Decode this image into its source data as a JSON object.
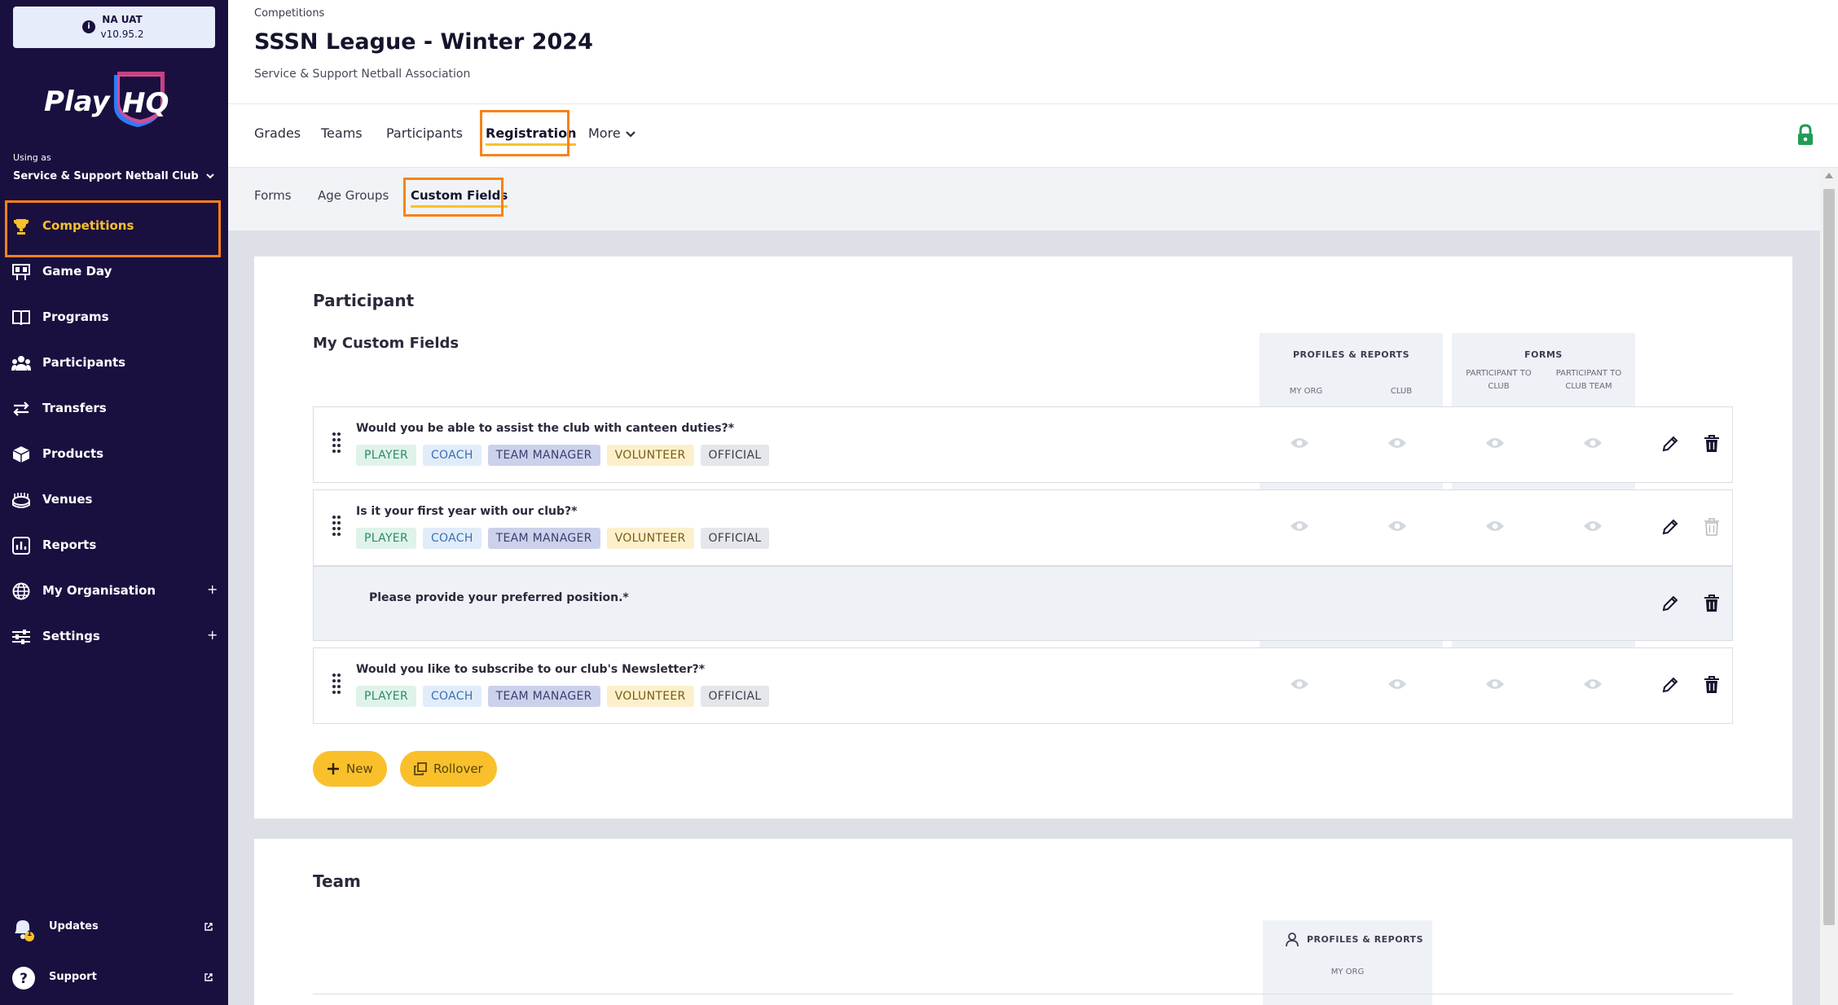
{
  "env": {
    "name": "NA UAT",
    "version": "v10.95.2",
    "info_icon": "i"
  },
  "sidebar": {
    "using_as_label": "Using as",
    "org_name": "Service & Support Netball Club",
    "items": [
      {
        "label": "Competitions",
        "icon": "trophy-icon",
        "active": true
      },
      {
        "label": "Game Day",
        "icon": "scoreboard-icon"
      },
      {
        "label": "Programs",
        "icon": "book-icon"
      },
      {
        "label": "Participants",
        "icon": "people-icon"
      },
      {
        "label": "Transfers",
        "icon": "transfer-arrows-icon"
      },
      {
        "label": "Products",
        "icon": "boxes-icon"
      },
      {
        "label": "Venues",
        "icon": "stadium-icon"
      },
      {
        "label": "Reports",
        "icon": "report-chart-icon"
      },
      {
        "label": "My Organisation",
        "icon": "globe-icon",
        "expand": "+"
      },
      {
        "label": "Settings",
        "icon": "sliders-icon",
        "expand": "+"
      }
    ],
    "updates": {
      "label": "Updates",
      "badge": "1"
    },
    "support": {
      "label": "Support"
    }
  },
  "header": {
    "breadcrumb": "Competitions",
    "title": "SSSN League - Winter 2024",
    "subtitle": "Service & Support Netball Association"
  },
  "tabs": [
    "Grades",
    "Teams",
    "Participants",
    "Registration",
    "More"
  ],
  "active_tab": "Registration",
  "subtabs": [
    "Forms",
    "Age Groups",
    "Custom Fields"
  ],
  "active_subtab": "Custom Fields",
  "participant": {
    "section_title": "Participant",
    "fields_title": "My Custom Fields",
    "groups": [
      {
        "title": "PROFILES & REPORTS",
        "cols": [
          "MY ORG",
          "CLUB"
        ]
      },
      {
        "title": "FORMS",
        "cols": [
          "PARTICIPANT TO CLUB",
          "PARTICIPANT TO CLUB TEAM"
        ]
      }
    ],
    "rows": [
      {
        "question": "Would you be able to assist the club with canteen duties?*",
        "tags": [
          "PLAYER",
          "COACH",
          "TEAM MANAGER",
          "VOLUNTEER",
          "OFFICIAL"
        ]
      },
      {
        "question": "Is it your first year with our club?*",
        "tags": [
          "PLAYER",
          "COACH",
          "TEAM MANAGER",
          "VOLUNTEER",
          "OFFICIAL"
        ]
      },
      {
        "question": "Please provide your preferred position.*"
      },
      {
        "question": "Would you like to subscribe to our club's Newsletter?*",
        "tags": [
          "PLAYER",
          "COACH",
          "TEAM MANAGER",
          "VOLUNTEER",
          "OFFICIAL"
        ]
      }
    ],
    "buttons": {
      "new": "New",
      "rollover": "Rollover"
    }
  },
  "team": {
    "section_title": "Team",
    "group": {
      "title": "PROFILES & REPORTS",
      "col": "MY ORG"
    }
  },
  "colors": {
    "sidebar": "#1a1040",
    "accent": "#f9c02c",
    "highlight": "#f7821b"
  }
}
